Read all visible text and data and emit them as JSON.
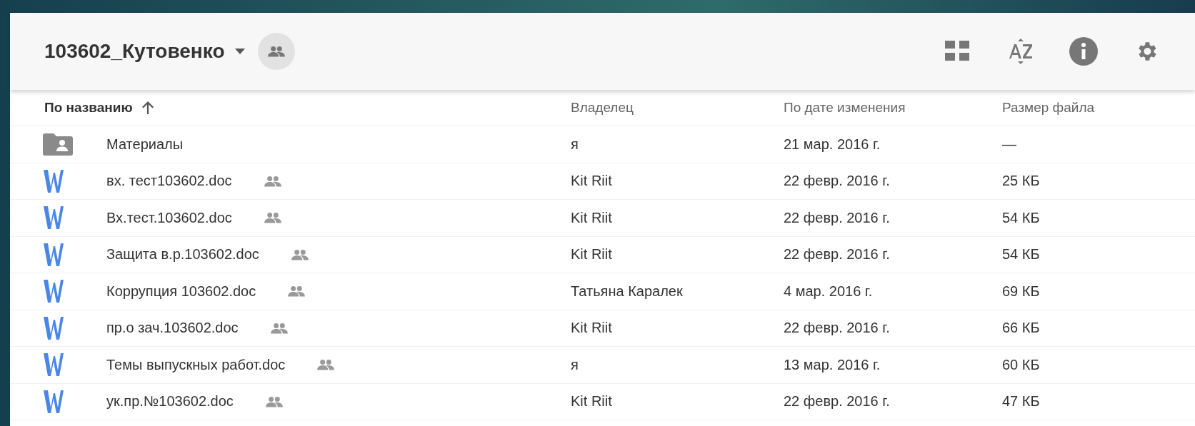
{
  "header": {
    "folder_title": "103602_Кутовенко"
  },
  "columns": [
    {
      "label": "По названию",
      "sorted": true
    },
    {
      "label": "Владелец",
      "sorted": false
    },
    {
      "label": "По дате изменения",
      "sorted": false
    },
    {
      "label": "Размер файла",
      "sorted": false
    }
  ],
  "rows": [
    {
      "kind": "folder",
      "name": "Материалы",
      "shared": false,
      "owner": "я",
      "modified": "21 мар. 2016 г.",
      "size": "—"
    },
    {
      "kind": "doc",
      "name": "вх. тест103602.doc",
      "shared": true,
      "owner": "Kit Riit",
      "modified": "22 февр. 2016 г.",
      "size": "25 КБ"
    },
    {
      "kind": "doc",
      "name": "Вх.тест.103602.doc",
      "shared": true,
      "owner": "Kit Riit",
      "modified": "22 февр. 2016 г.",
      "size": "54 КБ"
    },
    {
      "kind": "doc",
      "name": "Защита в.р.103602.doc",
      "shared": true,
      "owner": "Kit Riit",
      "modified": "22 февр. 2016 г.",
      "size": "54 КБ"
    },
    {
      "kind": "doc",
      "name": "Коррупция 103602.doc",
      "shared": true,
      "owner": "Татьяна Каралек",
      "modified": "4 мар. 2016 г.",
      "size": "69 КБ"
    },
    {
      "kind": "doc",
      "name": "пр.о зач.103602.doc",
      "shared": true,
      "owner": "Kit Riit",
      "modified": "22 февр. 2016 г.",
      "size": "66 КБ"
    },
    {
      "kind": "doc",
      "name": "Темы выпускных работ.doc",
      "shared": true,
      "owner": "я",
      "modified": "13 мар. 2016 г.",
      "size": "60 КБ"
    },
    {
      "kind": "doc",
      "name": "ук.пр.№103602.doc",
      "shared": true,
      "owner": "Kit Riit",
      "modified": "22 февр. 2016 г.",
      "size": "47 КБ"
    }
  ]
}
